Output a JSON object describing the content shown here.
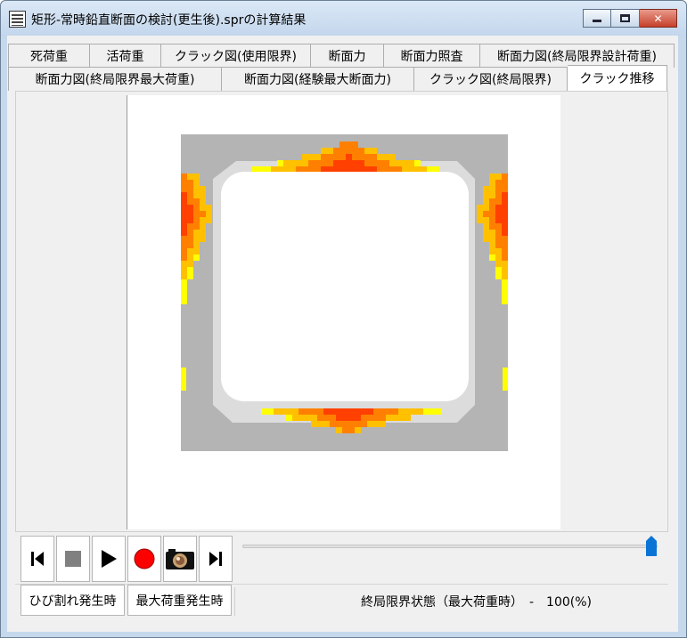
{
  "window": {
    "title": "矩形-常時鉛直断面の検討(更生後).sprの計算結果",
    "minimize_glyph": "",
    "maximize_glyph": "",
    "close_glyph": "✕"
  },
  "tabs_row1": [
    {
      "label": "死荷重"
    },
    {
      "label": "活荷重"
    },
    {
      "label": "クラック図(使用限界)"
    },
    {
      "label": "断面力"
    },
    {
      "label": "断面力照査"
    },
    {
      "label": "断面力図(終局限界設計荷重)"
    }
  ],
  "tabs_row2": [
    {
      "label": "断面力図(終局限界最大荷重)"
    },
    {
      "label": "断面力図(経験最大断面力)"
    },
    {
      "label": "クラック図(終局限界)"
    },
    {
      "label": "クラック推移",
      "active": true
    }
  ],
  "player": {
    "buttons": [
      "skip-to-start",
      "stop",
      "play",
      "record",
      "camera",
      "skip-to-end"
    ],
    "slider_value": 1.0
  },
  "bottom": {
    "crack_onset_label": "ひび割れ発生時",
    "max_load_label": "最大荷重発生時",
    "status": "終局限界状態（最大荷重時）　-　100(%)"
  },
  "colors": {
    "concrete": "#b4b4b4",
    "lining": "#dcdcdc",
    "crack_low": "#ffff00",
    "crack_mid": "#ffc000",
    "crack_high": "#ff8000",
    "crack_max": "#ff4000",
    "slider_thumb": "#0a74d6"
  }
}
